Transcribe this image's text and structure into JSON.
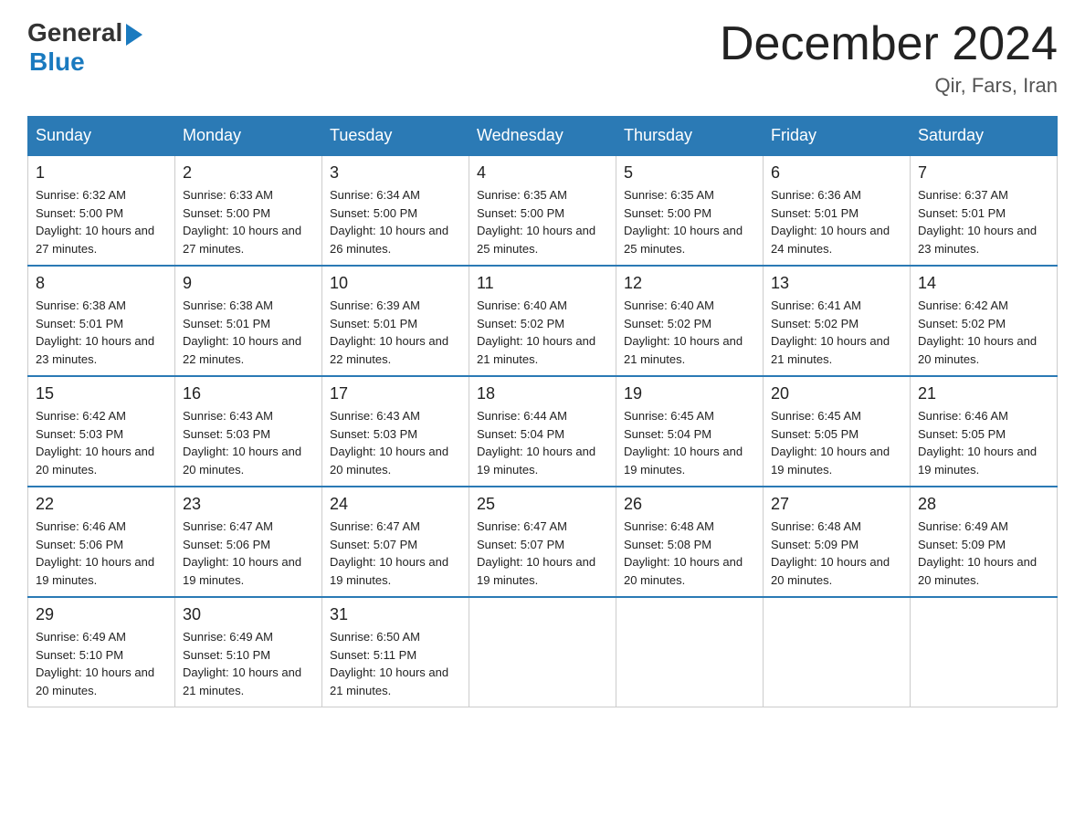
{
  "header": {
    "logo_general": "General",
    "logo_blue": "Blue",
    "month_title": "December 2024",
    "location": "Qir, Fars, Iran"
  },
  "days_of_week": [
    "Sunday",
    "Monday",
    "Tuesday",
    "Wednesday",
    "Thursday",
    "Friday",
    "Saturday"
  ],
  "weeks": [
    [
      {
        "day": "1",
        "sunrise": "6:32 AM",
        "sunset": "5:00 PM",
        "daylight": "10 hours and 27 minutes."
      },
      {
        "day": "2",
        "sunrise": "6:33 AM",
        "sunset": "5:00 PM",
        "daylight": "10 hours and 27 minutes."
      },
      {
        "day": "3",
        "sunrise": "6:34 AM",
        "sunset": "5:00 PM",
        "daylight": "10 hours and 26 minutes."
      },
      {
        "day": "4",
        "sunrise": "6:35 AM",
        "sunset": "5:00 PM",
        "daylight": "10 hours and 25 minutes."
      },
      {
        "day": "5",
        "sunrise": "6:35 AM",
        "sunset": "5:00 PM",
        "daylight": "10 hours and 25 minutes."
      },
      {
        "day": "6",
        "sunrise": "6:36 AM",
        "sunset": "5:01 PM",
        "daylight": "10 hours and 24 minutes."
      },
      {
        "day": "7",
        "sunrise": "6:37 AM",
        "sunset": "5:01 PM",
        "daylight": "10 hours and 23 minutes."
      }
    ],
    [
      {
        "day": "8",
        "sunrise": "6:38 AM",
        "sunset": "5:01 PM",
        "daylight": "10 hours and 23 minutes."
      },
      {
        "day": "9",
        "sunrise": "6:38 AM",
        "sunset": "5:01 PM",
        "daylight": "10 hours and 22 minutes."
      },
      {
        "day": "10",
        "sunrise": "6:39 AM",
        "sunset": "5:01 PM",
        "daylight": "10 hours and 22 minutes."
      },
      {
        "day": "11",
        "sunrise": "6:40 AM",
        "sunset": "5:02 PM",
        "daylight": "10 hours and 21 minutes."
      },
      {
        "day": "12",
        "sunrise": "6:40 AM",
        "sunset": "5:02 PM",
        "daylight": "10 hours and 21 minutes."
      },
      {
        "day": "13",
        "sunrise": "6:41 AM",
        "sunset": "5:02 PM",
        "daylight": "10 hours and 21 minutes."
      },
      {
        "day": "14",
        "sunrise": "6:42 AM",
        "sunset": "5:02 PM",
        "daylight": "10 hours and 20 minutes."
      }
    ],
    [
      {
        "day": "15",
        "sunrise": "6:42 AM",
        "sunset": "5:03 PM",
        "daylight": "10 hours and 20 minutes."
      },
      {
        "day": "16",
        "sunrise": "6:43 AM",
        "sunset": "5:03 PM",
        "daylight": "10 hours and 20 minutes."
      },
      {
        "day": "17",
        "sunrise": "6:43 AM",
        "sunset": "5:03 PM",
        "daylight": "10 hours and 20 minutes."
      },
      {
        "day": "18",
        "sunrise": "6:44 AM",
        "sunset": "5:04 PM",
        "daylight": "10 hours and 19 minutes."
      },
      {
        "day": "19",
        "sunrise": "6:45 AM",
        "sunset": "5:04 PM",
        "daylight": "10 hours and 19 minutes."
      },
      {
        "day": "20",
        "sunrise": "6:45 AM",
        "sunset": "5:05 PM",
        "daylight": "10 hours and 19 minutes."
      },
      {
        "day": "21",
        "sunrise": "6:46 AM",
        "sunset": "5:05 PM",
        "daylight": "10 hours and 19 minutes."
      }
    ],
    [
      {
        "day": "22",
        "sunrise": "6:46 AM",
        "sunset": "5:06 PM",
        "daylight": "10 hours and 19 minutes."
      },
      {
        "day": "23",
        "sunrise": "6:47 AM",
        "sunset": "5:06 PM",
        "daylight": "10 hours and 19 minutes."
      },
      {
        "day": "24",
        "sunrise": "6:47 AM",
        "sunset": "5:07 PM",
        "daylight": "10 hours and 19 minutes."
      },
      {
        "day": "25",
        "sunrise": "6:47 AM",
        "sunset": "5:07 PM",
        "daylight": "10 hours and 19 minutes."
      },
      {
        "day": "26",
        "sunrise": "6:48 AM",
        "sunset": "5:08 PM",
        "daylight": "10 hours and 20 minutes."
      },
      {
        "day": "27",
        "sunrise": "6:48 AM",
        "sunset": "5:09 PM",
        "daylight": "10 hours and 20 minutes."
      },
      {
        "day": "28",
        "sunrise": "6:49 AM",
        "sunset": "5:09 PM",
        "daylight": "10 hours and 20 minutes."
      }
    ],
    [
      {
        "day": "29",
        "sunrise": "6:49 AM",
        "sunset": "5:10 PM",
        "daylight": "10 hours and 20 minutes."
      },
      {
        "day": "30",
        "sunrise": "6:49 AM",
        "sunset": "5:10 PM",
        "daylight": "10 hours and 21 minutes."
      },
      {
        "day": "31",
        "sunrise": "6:50 AM",
        "sunset": "5:11 PM",
        "daylight": "10 hours and 21 minutes."
      },
      null,
      null,
      null,
      null
    ]
  ],
  "labels": {
    "sunrise_prefix": "Sunrise: ",
    "sunset_prefix": "Sunset: ",
    "daylight_prefix": "Daylight: "
  }
}
